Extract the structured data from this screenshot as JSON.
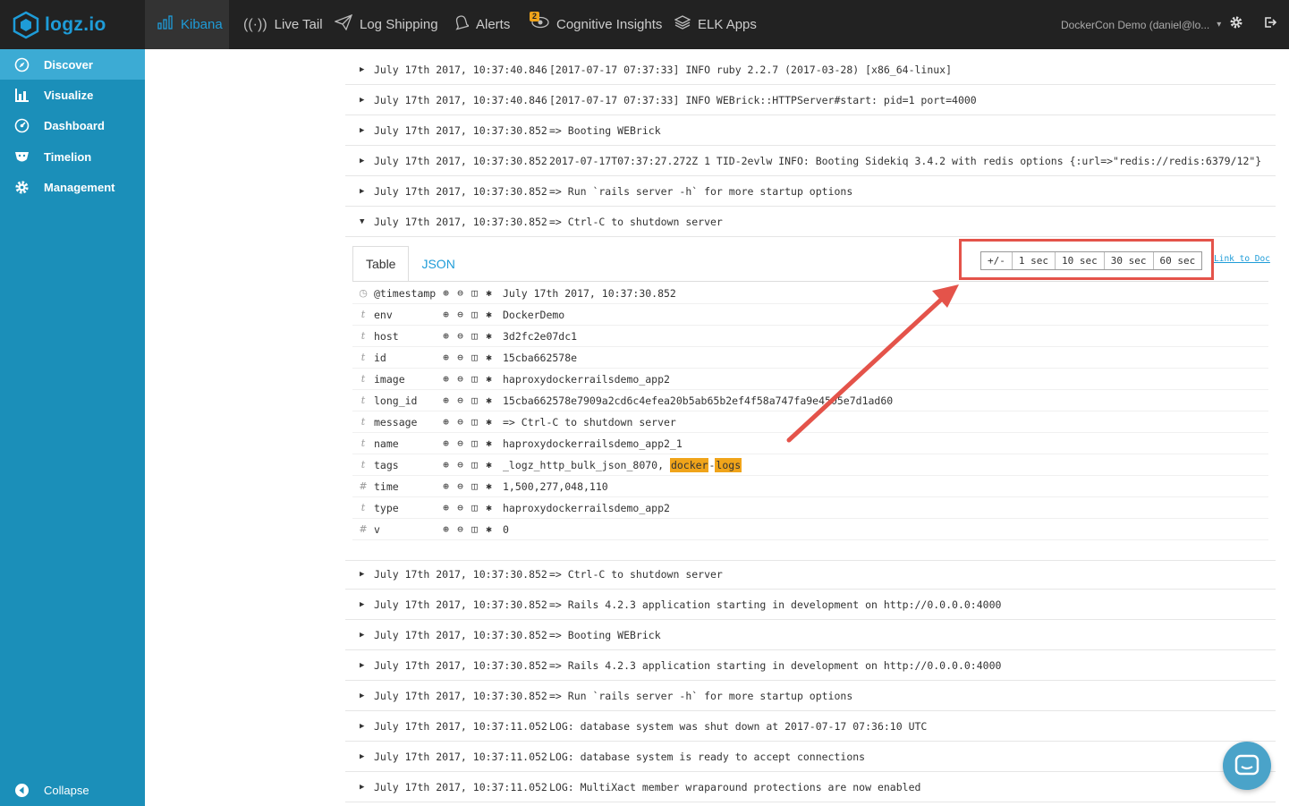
{
  "brand": {
    "logo_text": "logz.io"
  },
  "topnav": {
    "items": [
      {
        "label": "Kibana",
        "icon": "bar-chart-icon",
        "active": true
      },
      {
        "label": "Live Tail",
        "icon": "broadcast-icon"
      },
      {
        "label": "Log Shipping",
        "icon": "paper-plane-icon"
      },
      {
        "label": "Alerts",
        "icon": "bell-icon"
      },
      {
        "label": "Cognitive Insights",
        "icon": "eye-icon",
        "badge": "2"
      },
      {
        "label": "ELK Apps",
        "icon": "layers-icon"
      }
    ],
    "user": "DockerCon Demo (daniel@lo...",
    "user_caret": "▾",
    "settings_icon": "gear-icon",
    "logout_icon": "logout-icon"
  },
  "sidebar": {
    "items": [
      {
        "label": "Discover",
        "icon": "compass-icon",
        "active": true
      },
      {
        "label": "Visualize",
        "icon": "bar-chart-icon"
      },
      {
        "label": "Dashboard",
        "icon": "dashboard-icon"
      },
      {
        "label": "Timelion",
        "icon": "timelion-icon"
      },
      {
        "label": "Management",
        "icon": "gear-icon"
      }
    ],
    "collapse_label": "Collapse"
  },
  "log_rows_top": [
    {
      "ts": "July 17th 2017, 10:37:40.846",
      "msg": "[2017-07-17 07:37:33] INFO  ruby 2.2.7 (2017-03-28) [x86_64-linux]"
    },
    {
      "ts": "July 17th 2017, 10:37:40.846",
      "msg": "[2017-07-17 07:37:33] INFO  WEBrick::HTTPServer#start: pid=1 port=4000"
    },
    {
      "ts": "July 17th 2017, 10:37:30.852",
      "msg": "=> Booting WEBrick"
    },
    {
      "ts": "July 17th 2017, 10:37:30.852",
      "msg": "2017-07-17T07:37:27.272Z 1 TID-2evlw INFO: Booting Sidekiq 3.4.2 with redis options {:url=>\"redis://redis:6379/12\"}"
    },
    {
      "ts": "July 17th 2017, 10:37:30.852",
      "msg": "=> Run `rails server -h` for more startup options"
    },
    {
      "ts": "July 17th 2017, 10:37:30.852",
      "msg": "=> Ctrl-C to shutdown server"
    }
  ],
  "detail": {
    "tabs": [
      "Table",
      "JSON"
    ],
    "fields": [
      {
        "type": "◷",
        "name": "@timestamp",
        "value": "July 17th 2017, 10:37:30.852"
      },
      {
        "type": "t",
        "name": "env",
        "value": "DockerDemo"
      },
      {
        "type": "t",
        "name": "host",
        "value": "3d2fc2e07dc1"
      },
      {
        "type": "t",
        "name": "id",
        "value": "15cba662578e"
      },
      {
        "type": "t",
        "name": "image",
        "value": "haproxydockerrailsdemo_app2"
      },
      {
        "type": "t",
        "name": "long_id",
        "value": "15cba662578e7909a2cd6c4efea20b5ab65b2ef4f58a747fa9e4505e7d1ad60"
      },
      {
        "type": "t",
        "name": "message",
        "value": "=> Ctrl-C to shutdown server"
      },
      {
        "type": "t",
        "name": "name",
        "value": "haproxydockerrailsdemo_app2_1"
      },
      {
        "type": "t",
        "name": "tags",
        "value_prefix": "_logz_http_bulk_json_8070, ",
        "hl1": "docker",
        "sep": "-",
        "hl2": "logs"
      },
      {
        "type": "#",
        "name": "time",
        "value": "1,500,277,048,110"
      },
      {
        "type": "t",
        "name": "type",
        "value": "haproxydockerrailsdemo_app2"
      },
      {
        "type": "#",
        "name": "v",
        "value": "0"
      }
    ],
    "time_buttons": [
      "+/-",
      "1 sec",
      "10 sec",
      "30 sec",
      "60 sec"
    ],
    "link_to_doc": "Link to Doc"
  },
  "log_rows_bottom": [
    {
      "ts": "July 17th 2017, 10:37:30.852",
      "msg": "=> Ctrl-C to shutdown server"
    },
    {
      "ts": "July 17th 2017, 10:37:30.852",
      "msg": "=> Rails 4.2.3 application starting in development on http://0.0.0.0:4000"
    },
    {
      "ts": "July 17th 2017, 10:37:30.852",
      "msg": "=> Booting WEBrick"
    },
    {
      "ts": "July 17th 2017, 10:37:30.852",
      "msg": "=> Rails 4.2.3 application starting in development on http://0.0.0.0:4000"
    },
    {
      "ts": "July 17th 2017, 10:37:30.852",
      "msg": "=> Run `rails server -h` for more startup options"
    },
    {
      "ts": "July 17th 2017, 10:37:11.052",
      "msg": "LOG:  database system was shut down at 2017-07-17 07:36:10 UTC"
    },
    {
      "ts": "July 17th 2017, 10:37:11.052",
      "msg": "LOG:  database system is ready to accept connections"
    },
    {
      "ts": "July 17th 2017, 10:37:11.052",
      "msg": "LOG:  MultiXact member wraparound protections are now enabled"
    }
  ],
  "colors": {
    "accent": "#1e9cd8",
    "sidebar": "#1b8fb9",
    "highlight": "#f0a41a",
    "annotation": "#e4534a"
  }
}
